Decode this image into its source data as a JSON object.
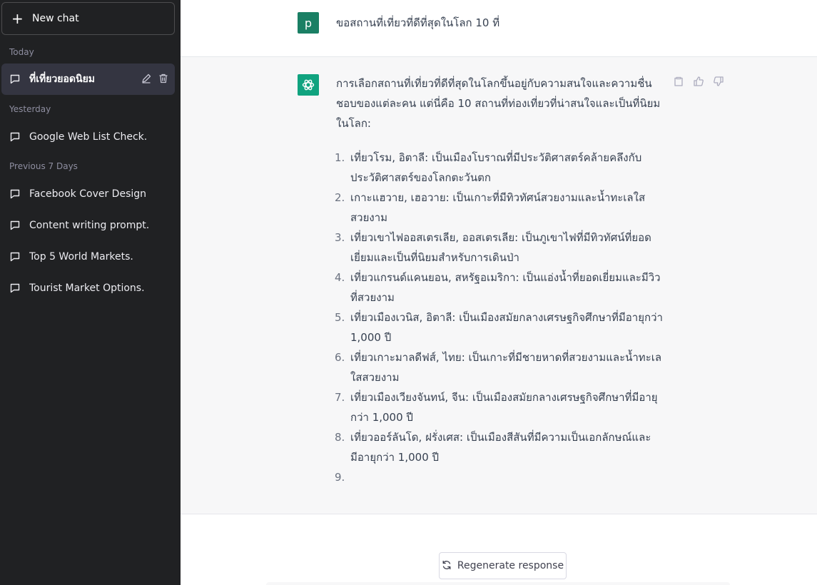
{
  "sidebar": {
    "new_chat_label": "New chat",
    "sections": {
      "today": "Today",
      "yesterday": "Yesterday",
      "previous_7_days": "Previous 7 Days"
    },
    "conversations": [
      {
        "title": "ที่เที่ยวยอดนิยม"
      },
      {
        "title": "Google Web List Check."
      },
      {
        "title": "Facebook Cover Design"
      },
      {
        "title": "Content writing prompt."
      },
      {
        "title": "Top 5 World Markets."
      },
      {
        "title": "Tourist Market Options."
      }
    ]
  },
  "chat": {
    "user_avatar_letter": "p",
    "user_message": "ขอสถานที่เที่ยวที่ดีที่สุดในโลก 10 ที่",
    "assistant_intro": "การเลือกสถานที่เที่ยวที่ดีที่สุดในโลกขึ้นอยู่กับความสนใจและความชื่นชอบของแต่ละคน แต่นี่คือ 10 สถานที่ท่องเที่ยวที่น่าสนใจและเป็นที่นิยมในโลก:",
    "assistant_list": [
      {
        "num": "1.",
        "text": "เที่ยวโรม, อิตาลี: เป็นเมืองโบราณที่มีประวัติศาสตร์คล้ายคลึงกับประวัติศาสตร์ของโลกตะวันตก"
      },
      {
        "num": "2.",
        "text": "เกาะแฮวาย, เฮอวาย: เป็นเกาะที่มีทิวทัศน์สวยงามและน้ำทะเลใสสวยงาม"
      },
      {
        "num": "3.",
        "text": "เที่ยวเขาไฟออสเตรเลีย, ออสเตรเลีย: เป็นภูเขาไฟที่มีทิวทัศน์ที่ยอดเยี่ยมและเป็นที่นิยมสำหรับการเดินป่า"
      },
      {
        "num": "4.",
        "text": "เที่ยวแกรนด์แคนยอน, สหรัฐอเมริกา: เป็นแอ่งน้ำที่ยอดเยี่ยมและมีวิวที่สวยงาม"
      },
      {
        "num": "5.",
        "text": "เที่ยวเมืองเวนิส, อิตาลี: เป็นเมืองสมัยกลางเศรษฐกิจศึกษาที่มีอายุกว่า 1,000 ปี"
      },
      {
        "num": "6.",
        "text": "เที่ยวเกาะมาลดีฟส์, ไทย: เป็นเกาะที่มีชายหาดที่สวยงามและน้ำทะเลใสสวยงาม"
      },
      {
        "num": "7.",
        "text": "เที่ยวเมืองเวียงจันทน์, จีน: เป็นเมืองสมัยกลางเศรษฐกิจศึกษาที่มีอายุกว่า 1,000 ปี"
      },
      {
        "num": "8.",
        "text": "เที่ยวออร์ลันโด, ฝรั่งเศส: เป็นเมืองสีสันที่มีความเป็นเอกลักษณ์และมีอายุกว่า 1,000 ปี"
      },
      {
        "num": "9.",
        "text": ""
      }
    ],
    "regenerate_label": "Regenerate response"
  },
  "colors": {
    "sidebar_bg": "#202123",
    "active_item_bg": "#343541",
    "assistant_bg": "#f7f7f8",
    "brand_green": "#10a37f",
    "user_avatar": "#1a7f64"
  },
  "icons": {
    "new_chat": "plus-icon",
    "conversation": "chat-bubble-icon",
    "edit": "pencil-icon",
    "delete": "trash-icon",
    "assistant_avatar": "openai-logo-icon",
    "copy": "clipboard-icon",
    "like": "thumbs-up-icon",
    "dislike": "thumbs-down-icon",
    "regenerate": "refresh-icon"
  }
}
